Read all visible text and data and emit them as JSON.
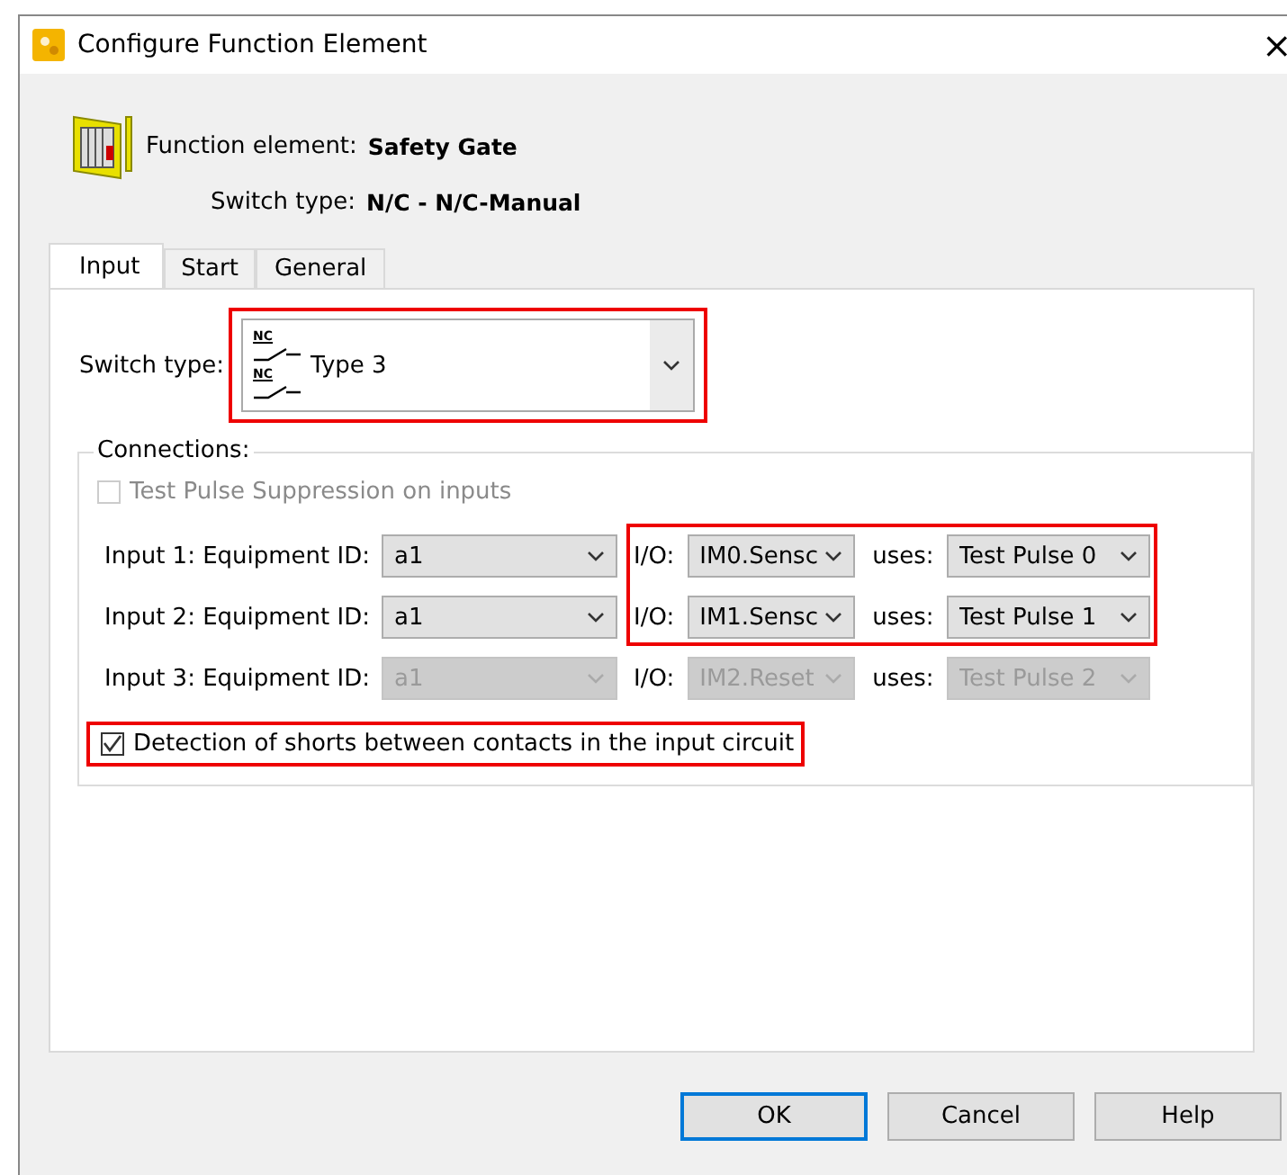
{
  "window": {
    "title": "Configure Function Element",
    "close": "×"
  },
  "header": {
    "element_label": "Function element:",
    "element_value": "Safety Gate",
    "switch_label": "Switch type:",
    "switch_value": "N/C - N/C-Manual"
  },
  "tabs": [
    {
      "label": "Input",
      "selected": true
    },
    {
      "label": "Start",
      "selected": false
    },
    {
      "label": "General",
      "selected": false
    }
  ],
  "switch_type": {
    "label": "Switch type:",
    "value": "Type 3",
    "symbol_labels": [
      "NC",
      "NC"
    ]
  },
  "connections": {
    "title": "Connections:",
    "test_pulse_suppression": {
      "label": "Test Pulse Suppression on inputs",
      "checked": false,
      "disabled": true
    },
    "inputs": [
      {
        "label": "Input 1: Equipment ID:",
        "equipment": "a1",
        "io_label": "I/O:",
        "io": "IM0.Sensc",
        "uses_label": "uses:",
        "pulse": "Test Pulse 0",
        "disabled": false
      },
      {
        "label": "Input 2: Equipment ID:",
        "equipment": "a1",
        "io_label": "I/O:",
        "io": "IM1.Sensc",
        "uses_label": "uses:",
        "pulse": "Test Pulse 1",
        "disabled": false
      },
      {
        "label": "Input 3: Equipment ID:",
        "equipment": "a1",
        "io_label": "I/O:",
        "io": "IM2.Reset",
        "uses_label": "uses:",
        "pulse": "Test Pulse 2",
        "disabled": true
      }
    ],
    "short_detection": {
      "label": "Detection of shorts between contacts in the input circuit",
      "checked": true,
      "disabled": false
    }
  },
  "buttons": [
    {
      "label": "OK",
      "default": true
    },
    {
      "label": "Cancel",
      "default": false
    },
    {
      "label": "Help",
      "default": false
    }
  ]
}
